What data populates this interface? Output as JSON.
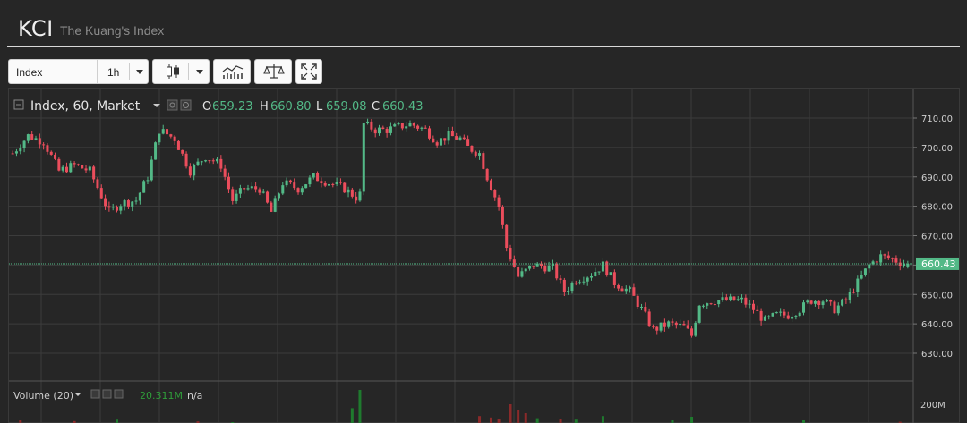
{
  "app": {
    "title": "KCI",
    "subtitle": "The Kuang's Index"
  },
  "toolbar": {
    "symbol": "Index",
    "interval": "1h",
    "chart_style_icon": "candlestick-icon",
    "indicators_icon": "indicators-icon",
    "compare_icon": "compare-scale-icon",
    "fullscreen_icon": "fullscreen-icon"
  },
  "legend": {
    "series_title": "Index, 60, Market",
    "o_label": "O",
    "o_value": "659.23",
    "h_label": "H",
    "h_value": "660.80",
    "l_label": "L",
    "l_value": "659.08",
    "c_label": "C",
    "c_value": "660.43"
  },
  "volume_legend": {
    "title": "Volume (20)",
    "value": "20.311M",
    "na": "n/a"
  },
  "colors": {
    "up": "#53b987",
    "down": "#eb4d5c",
    "background": "#262626",
    "grid": "#3c3c3c",
    "last_line": "#53b987"
  },
  "chart_data": {
    "type": "candlestick",
    "interval": "60",
    "ylim": [
      623,
      713
    ],
    "yticks": [
      "710.00",
      "700.00",
      "690.00",
      "680.00",
      "670.00",
      "660.00",
      "650.00",
      "640.00",
      "630.00"
    ],
    "last_price": "660.43",
    "volume_tick": "200M",
    "grid": true,
    "close_path": [
      [
        0,
        698
      ],
      [
        4,
        704
      ],
      [
        8,
        702
      ],
      [
        12,
        692
      ],
      [
        16,
        694
      ],
      [
        20,
        692
      ],
      [
        25,
        678
      ],
      [
        28,
        681
      ],
      [
        32,
        682
      ],
      [
        35,
        690
      ],
      [
        38,
        706
      ],
      [
        42,
        703
      ],
      [
        46,
        692
      ],
      [
        50,
        697
      ],
      [
        54,
        694
      ],
      [
        57,
        682
      ],
      [
        60,
        686
      ],
      [
        64,
        686
      ],
      [
        67,
        678
      ],
      [
        70,
        688
      ],
      [
        74,
        686
      ],
      [
        78,
        690
      ],
      [
        82,
        688
      ],
      [
        86,
        686
      ],
      [
        89,
        683
      ],
      [
        90,
        684
      ],
      [
        91,
        708
      ],
      [
        94,
        706
      ],
      [
        97,
        706
      ],
      [
        100,
        707
      ],
      [
        103,
        708
      ],
      [
        107,
        706
      ],
      [
        110,
        702
      ],
      [
        113,
        704
      ],
      [
        116,
        703
      ],
      [
        118,
        700
      ],
      [
        121,
        698
      ],
      [
        123,
        690
      ],
      [
        126,
        680
      ],
      [
        128,
        666
      ],
      [
        131,
        656
      ],
      [
        135,
        660
      ],
      [
        140,
        659
      ],
      [
        143,
        651
      ],
      [
        146,
        655
      ],
      [
        150,
        657
      ],
      [
        153,
        660
      ],
      [
        156,
        654
      ],
      [
        160,
        651
      ],
      [
        163,
        645
      ],
      [
        166,
        638
      ],
      [
        170,
        640
      ],
      [
        174,
        639
      ],
      [
        176,
        636
      ],
      [
        178,
        647
      ],
      [
        182,
        648
      ],
      [
        186,
        648
      ],
      [
        189,
        648
      ],
      [
        192,
        645
      ],
      [
        195,
        641
      ],
      [
        198,
        643
      ],
      [
        201,
        643
      ],
      [
        204,
        645
      ],
      [
        207,
        648
      ],
      [
        210,
        648
      ],
      [
        213,
        645
      ],
      [
        216,
        648
      ],
      [
        219,
        654
      ],
      [
        222,
        660
      ],
      [
        225,
        663
      ],
      [
        228,
        662
      ],
      [
        230,
        661
      ],
      [
        232,
        660.43
      ]
    ],
    "volume_bars": [
      [
        2,
        0.1,
        "down"
      ],
      [
        16,
        0.08,
        "down"
      ],
      [
        27,
        0.12,
        "up"
      ],
      [
        48,
        0.07,
        "down"
      ],
      [
        57,
        0.05,
        "up"
      ],
      [
        88,
        0.44,
        "up"
      ],
      [
        90,
        0.95,
        "up"
      ],
      [
        121,
        0.22,
        "down"
      ],
      [
        124,
        0.18,
        "down"
      ],
      [
        126,
        0.14,
        "down"
      ],
      [
        129,
        0.55,
        "down"
      ],
      [
        131,
        0.4,
        "down"
      ],
      [
        133,
        0.3,
        "down"
      ],
      [
        136,
        0.16,
        "up"
      ],
      [
        142,
        0.14,
        "down"
      ],
      [
        146,
        0.12,
        "up"
      ],
      [
        153,
        0.22,
        "up"
      ],
      [
        171,
        0.1,
        "up"
      ],
      [
        176,
        0.2,
        "up"
      ],
      [
        205,
        0.1,
        "up"
      ],
      [
        230,
        0.06,
        "down"
      ]
    ]
  }
}
